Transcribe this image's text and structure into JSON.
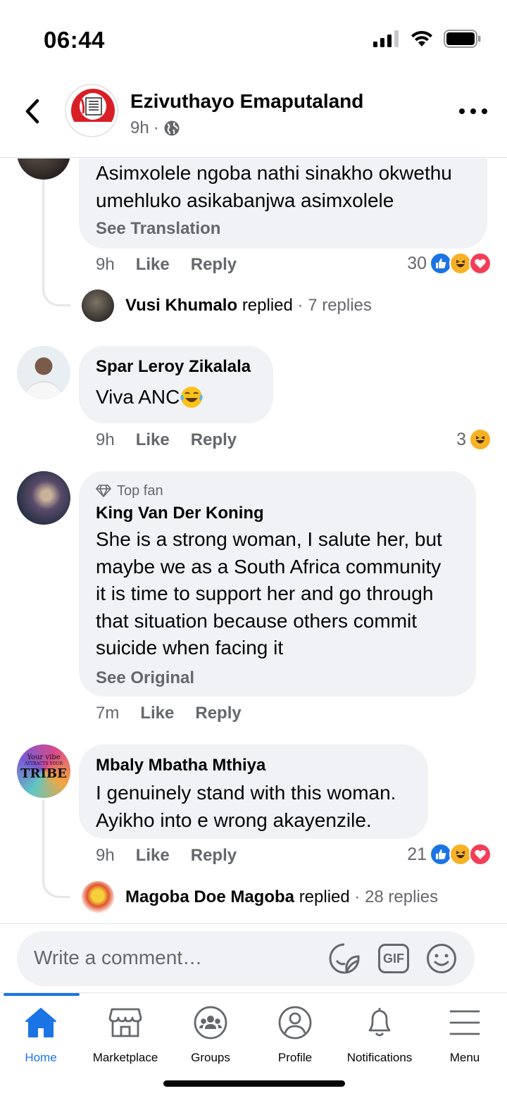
{
  "status_bar": {
    "time": "06:44"
  },
  "header": {
    "page_name": "Ezivuthayo Emaputaland",
    "time": "9h",
    "separator": "·"
  },
  "comments": [
    {
      "text": "Asimxolele ngoba nathi sinakho okwethu umehluko asikabanjwa asimxolele",
      "see_label": "See Translation",
      "time": "9h",
      "like": "Like",
      "reply": "Reply",
      "reaction_count": "30",
      "reactions": [
        "like",
        "haha",
        "love"
      ],
      "replied": {
        "name": "Vusi Khumalo",
        "verb": "replied",
        "count": "· 7 replies"
      }
    },
    {
      "author": "Spar Leroy Zikalala",
      "text": "Viva ANC",
      "emoji": "laughing-tears",
      "time": "9h",
      "like": "Like",
      "reply": "Reply",
      "reaction_count": "3",
      "reactions": [
        "haha"
      ]
    },
    {
      "badge": "Top fan",
      "author": "King Van Der Koning",
      "text_lines": [
        "She is a strong woman, I salute her, but",
        "maybe we as a South Africa community",
        "it is time to support her and go through",
        "that situation because others commit",
        "suicide when facing it"
      ],
      "see_label": "See Original",
      "time": "7m",
      "like": "Like",
      "reply": "Reply"
    },
    {
      "author": "Mbaly Mbatha Mthiya",
      "avatar_text": [
        "Your vibe",
        "ATTRACTS YOUR",
        "TRIBE"
      ],
      "text_lines": [
        "I genuinely stand with this woman.",
        "Ayikho into e wrong akayenzile."
      ],
      "time": "9h",
      "like": "Like",
      "reply": "Reply",
      "reaction_count": "21",
      "reactions": [
        "like",
        "haha",
        "love"
      ],
      "replied": {
        "name": "Magoba Doe Magoba",
        "verb": "replied",
        "count": "· 28 replies"
      }
    }
  ],
  "composer": {
    "placeholder": "Write a comment…",
    "gif_label": "GIF"
  },
  "nav": [
    {
      "label": "Home",
      "icon": "home-icon",
      "active": true
    },
    {
      "label": "Marketplace",
      "icon": "marketplace-icon"
    },
    {
      "label": "Groups",
      "icon": "groups-icon"
    },
    {
      "label": "Profile",
      "icon": "profile-icon"
    },
    {
      "label": "Notifications",
      "icon": "bell-icon"
    },
    {
      "label": "Menu",
      "icon": "menu-icon"
    }
  ],
  "colors": {
    "accent": "#1b74e4",
    "bubble": "#f0f2f5",
    "secondary_text": "#65676b",
    "love": "#f33e58",
    "haha": "#f7b125"
  }
}
